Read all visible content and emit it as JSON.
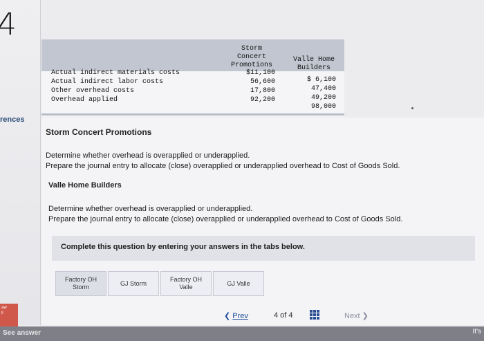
{
  "page": {
    "number": "4",
    "left_label": "rences"
  },
  "table": {
    "col_storm": "Storm\nConcert\nPromotions",
    "col_valle": "Valle Home\nBuilders",
    "rows": {
      "labels": "Actual indirect materials costs\nActual indirect labor costs\nOther overhead costs\nOverhead applied",
      "storm": "$11,100\n56,600\n17,800\n92,200",
      "valle": "$ 6,100\n47,400\n49,200\n98,000"
    }
  },
  "storm": {
    "heading": "Storm Concert Promotions",
    "line1": "Determine whether overhead is overapplied or underapplied.",
    "line2": "Prepare the journal entry to allocate (close) overapplied or underapplied overhead to Cost of Goods Sold."
  },
  "valle": {
    "heading": "Valle Home Builders",
    "line1": "Determine whether overhead is overapplied or underapplied.",
    "line2": "Prepare the journal entry to allocate (close) overapplied or underapplied overhead to Cost of Goods Sold."
  },
  "instructions": "Complete this question by entering your answers in the tabs below.",
  "tabs": [
    "Factory OH\nStorm",
    "GJ Storm",
    "Factory OH\nValle",
    "GJ Valle"
  ],
  "pager": {
    "prev": "Prev",
    "count": "4 of 4",
    "next": "Next"
  },
  "footer": {
    "see_answer": "See answer",
    "badge": "aw\nll",
    "right": "It's"
  },
  "colors": {
    "link": "#1f4c9c",
    "header_band": "#c2c6d1",
    "badge": "#d0584a"
  }
}
